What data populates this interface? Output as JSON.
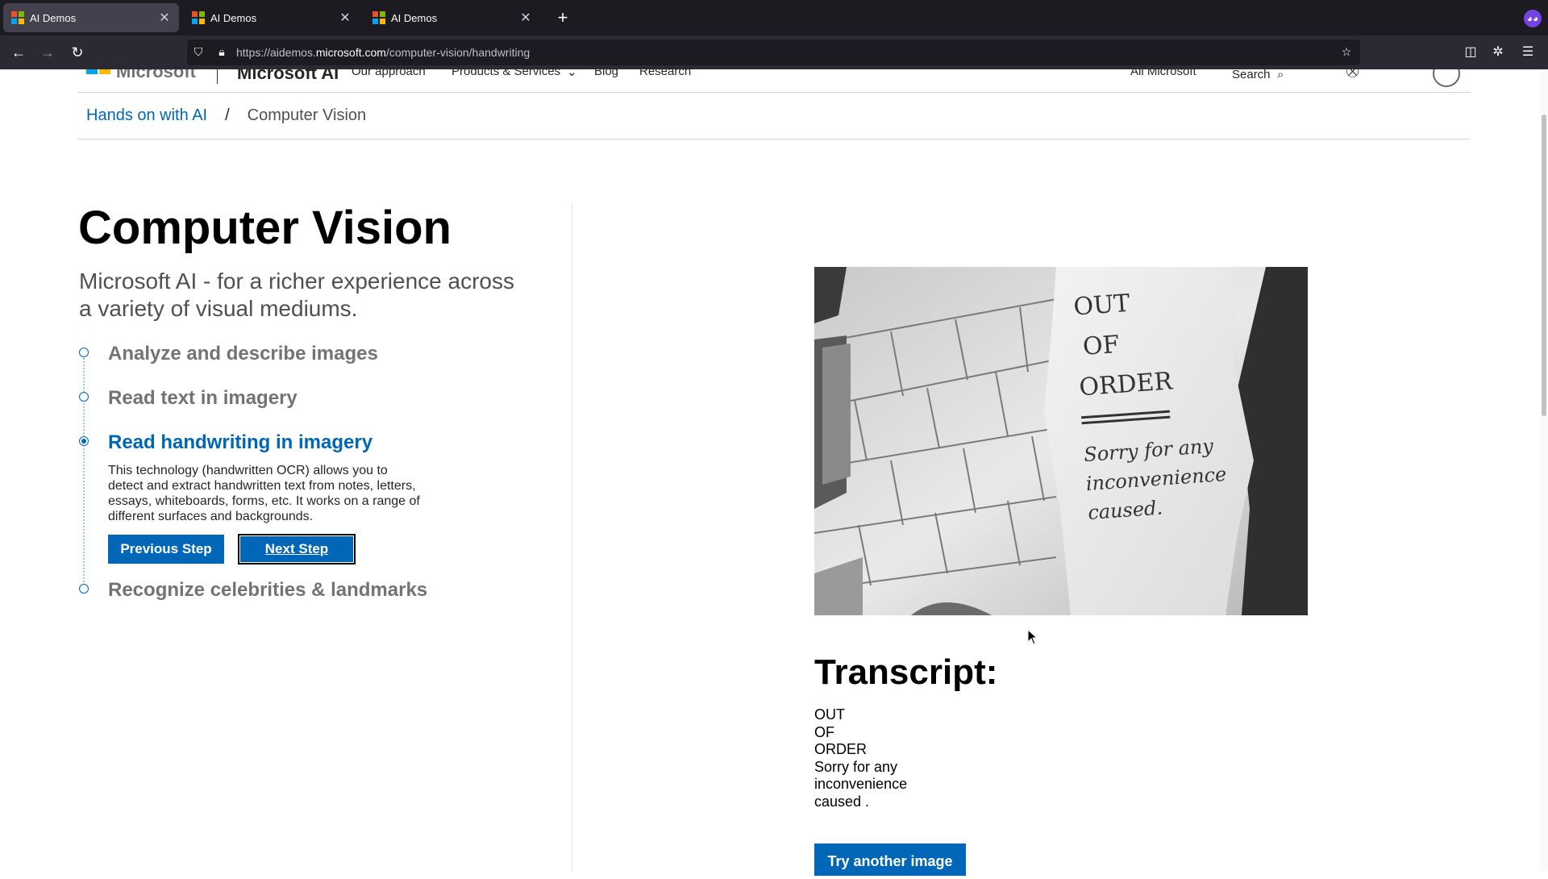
{
  "browser": {
    "tabs": [
      {
        "title": "AI Demos",
        "active": true
      },
      {
        "title": "AI Demos",
        "active": false
      },
      {
        "title": "AI Demos",
        "active": false
      }
    ],
    "url_prefix": "https://aidemos.",
    "url_domain": "microsoft.com",
    "url_path": "/computer-vision/handwriting"
  },
  "site_header": {
    "logo_text": "Microsoft",
    "brand": "Microsoft AI",
    "nav": [
      "Our approach",
      "Products & Services",
      "Blog",
      "Research"
    ],
    "all_microsoft": "All Microsoft",
    "search": "Search"
  },
  "breadcrumb": {
    "home": "Hands on with AI",
    "separator": "/",
    "current": "Computer Vision"
  },
  "main": {
    "title": "Computer Vision",
    "subtitle": "Microsoft AI - for a richer experience across a variety of visual mediums.",
    "steps": [
      {
        "label": "Analyze and describe images",
        "active": false
      },
      {
        "label": "Read text in imagery",
        "active": false
      },
      {
        "label": "Read handwriting in imagery",
        "active": true
      },
      {
        "label": "Recognize celebrities & landmarks",
        "active": false
      }
    ],
    "active_description": "This technology (handwritten OCR) allows you to detect and extract handwritten text from notes, letters, essays, whiteboards, forms, etc. It works on a range of different surfaces and backgrounds.",
    "previous_label": "Previous Step",
    "next_label": "Next Step"
  },
  "result": {
    "photo_handwriting": [
      "OUT",
      "OF",
      "ORDER",
      "Sorry for any",
      "inconvenience",
      "caused."
    ],
    "transcript_title": "Transcript:",
    "transcript_lines": [
      "OUT",
      "OF",
      "ORDER",
      "Sorry for any",
      "inconvenience",
      "caused ."
    ],
    "try_label": "Try another image"
  },
  "colors": {
    "accent": "#0067b8",
    "tabbar": "#1c1b22",
    "toolbar": "#2b2a33"
  }
}
